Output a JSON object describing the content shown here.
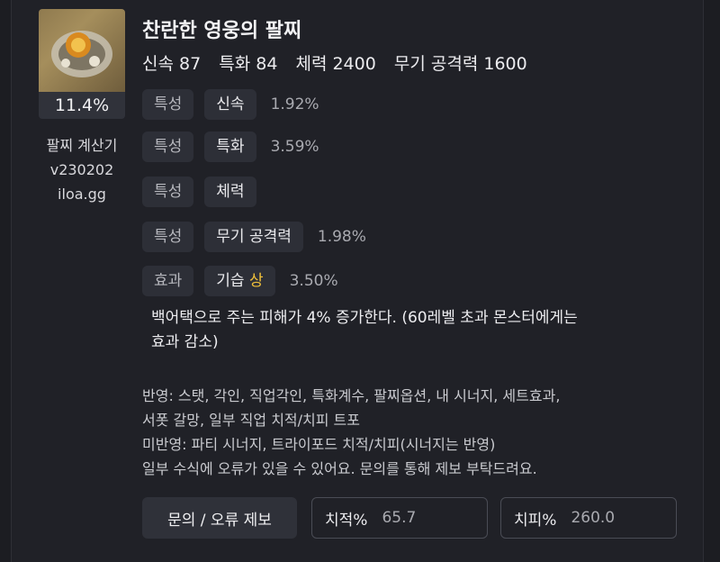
{
  "item": {
    "title": "찬란한 영웅의 팔찌",
    "percent": "11.4%",
    "stats": [
      "신속 87",
      "특화 84",
      "체력 2400",
      "무기 공격력 1600"
    ]
  },
  "calculator": {
    "name": "팔찌 계산기",
    "version": "v230202",
    "site": "iloa.gg"
  },
  "rows": [
    {
      "tag": "특성",
      "name": "신속",
      "value": "1.92%"
    },
    {
      "tag": "특성",
      "name": "특화",
      "value": "3.59%"
    },
    {
      "tag": "특성",
      "name": "체력",
      "value": ""
    },
    {
      "tag": "특성",
      "name": "무기 공격력",
      "value": "1.98%"
    },
    {
      "tag": "효과",
      "name": "기습",
      "grade": "상",
      "value": "3.50%"
    }
  ],
  "effect_desc_1": "백어택으로 주는 피해가 4% 증가한다. (60레벨 초과 몬스터에게는",
  "effect_desc_2": "효과 감소)",
  "notes": [
    "반영: 스탯, 각인, 직업각인, 특화계수, 팔찌옵션, 내 시너지, 세트효과,",
    "서폿 갈망, 일부 직업 치적/치피 트포",
    "미반영: 파티 시너지, 트라이포드 치적/치피(시너지는 반영)",
    "일부 수식에 오류가 있을 수 있어요. 문의를 통해 제보 부탁드려요."
  ],
  "footer": {
    "report_button": "문의 / 오류 제보",
    "crit_rate_label": "치적%",
    "crit_rate_value": "65.7",
    "crit_dmg_label": "치피%",
    "crit_dmg_value": "260.0"
  },
  "colors": {
    "background": "#202127",
    "chip": "#2d2f37",
    "grade_gold": "#f0c03a"
  }
}
